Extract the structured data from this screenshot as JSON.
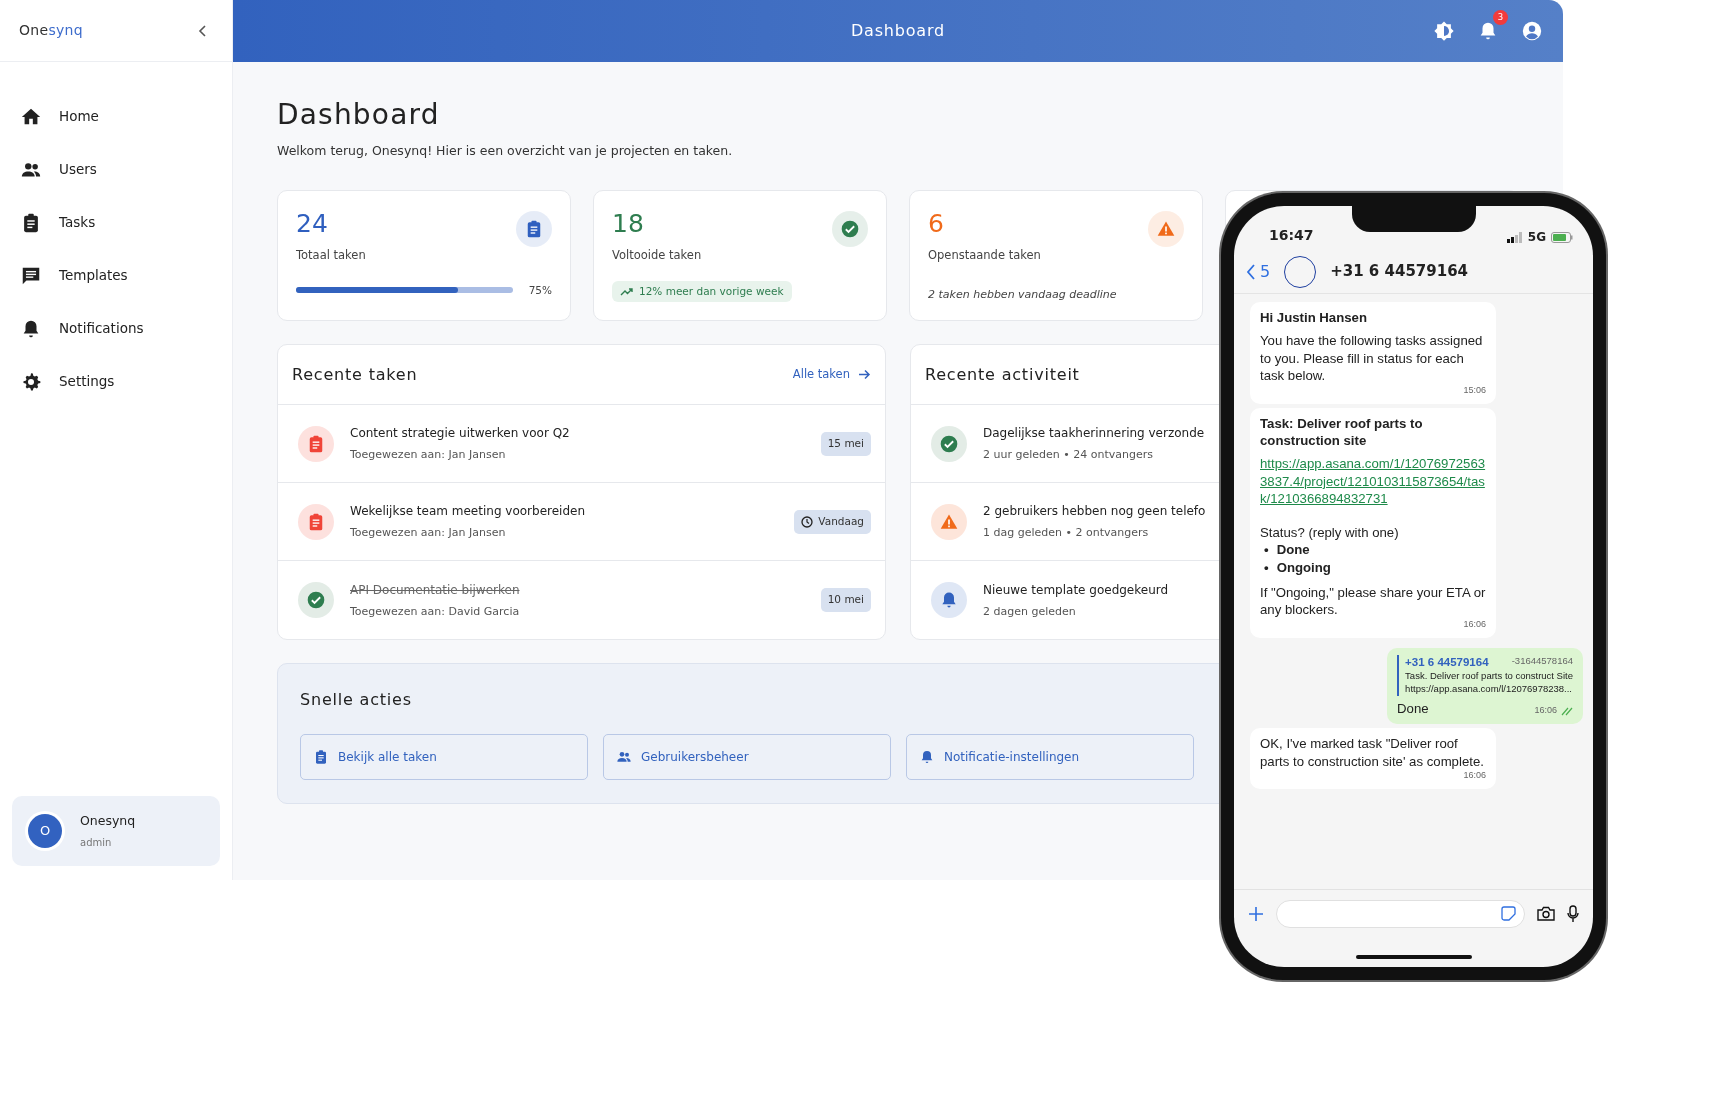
{
  "logo": {
    "base": "One",
    "accent": "synq"
  },
  "sidebar": {
    "items": [
      {
        "label": "Home"
      },
      {
        "label": "Users"
      },
      {
        "label": "Tasks"
      },
      {
        "label": "Templates"
      },
      {
        "label": "Notifications"
      },
      {
        "label": "Settings"
      }
    ],
    "user": {
      "avatar": "O",
      "name": "Onesynq",
      "role": "admin"
    }
  },
  "header": {
    "title": "Dashboard",
    "notification_count": "3"
  },
  "page": {
    "title": "Dashboard",
    "subtitle": "Welkom terug, Onesynq! Hier is een overzicht van je projecten en taken."
  },
  "stats": [
    {
      "kind": "progress",
      "value": "24",
      "label": "Totaal taken",
      "color": "#2f5fbf",
      "level": 0.75,
      "reading": "75%"
    },
    {
      "kind": "trend",
      "value": "18",
      "label": "Voltooide taken",
      "color": "#2e7d4f",
      "trend": "12% meer dan vorige week"
    },
    {
      "kind": "note",
      "value": "6",
      "label": "Openstaande taken",
      "color": "#f06a1a",
      "note": "2 taken hebben vandaag deadline"
    }
  ],
  "recent_tasks": {
    "title": "Recente taken",
    "link": "Alle taken",
    "items": [
      {
        "title": "Content strategie uitwerken voor Q2",
        "assignee": "Toegewezen aan: Jan Jansen",
        "badge": "15 mei",
        "due_today": false,
        "completed": false
      },
      {
        "title": "Wekelijkse team meeting voorbereiden",
        "assignee": "Toegewezen aan: Jan Jansen",
        "badge": "Vandaag",
        "due_today": true,
        "completed": false
      },
      {
        "title": "API Documentatie bijwerken",
        "assignee": "Toegewezen aan: David Garcia",
        "badge": "10 mei",
        "due_today": false,
        "completed": true
      }
    ]
  },
  "recent_activity": {
    "title": "Recente activiteit",
    "items": [
      {
        "kind": "success",
        "text": "Dagelijkse taakherinnering verzonde",
        "meta": "2 uur geleden • 24 ontvangers"
      },
      {
        "kind": "warning",
        "text": "2 gebruikers hebben nog geen telefo",
        "meta": "1 dag geleden • 2 ontvangers"
      },
      {
        "kind": "info",
        "text": "Nieuwe template goedgekeurd",
        "meta": "2 dagen geleden"
      }
    ]
  },
  "quick_actions": {
    "title": "Snelle acties",
    "buttons": [
      {
        "label": "Bekijk alle taken"
      },
      {
        "label": "Gebruikersbeheer"
      },
      {
        "label": "Notificatie-instellingen"
      }
    ]
  },
  "phone": {
    "time": "16:47",
    "network": "5G",
    "back_count": "5",
    "contact": "+31 6 44579164",
    "messages": [
      {
        "kind": "incoming",
        "title": "Hi Justin Hansen",
        "body": "You have the following tasks assigned to you. Please fill in status for each task below.",
        "time": "15:06"
      },
      {
        "kind": "task",
        "title": "Task: Deliver roof parts to construction site",
        "link": "https://app.asana.com/1/120769725633837.4/project/1210103115873654/task/1210366894832731",
        "question": "Status? (reply with one)",
        "options": [
          {
            "bullet": "•",
            "text": "Done"
          },
          {
            "bullet": "•",
            "text": "Ongoing"
          }
        ],
        "footer": "If \"Ongoing,\"  please share your ETA or any blockers.",
        "time": "16:06"
      },
      {
        "kind": "outgoing",
        "quote_name": "+31 6 44579164",
        "quote_number": "-31644578164",
        "quote_text": "Task. Deliver roof parts to construct Site",
        "quote_link": "https://app.asana.com/l/12076978238...",
        "text": "Done",
        "time": "16:06"
      },
      {
        "kind": "incoming",
        "body": "OK, I've marked task \"Deliver roof parts to construction site' as complete.",
        "time": "16:06"
      }
    ]
  }
}
